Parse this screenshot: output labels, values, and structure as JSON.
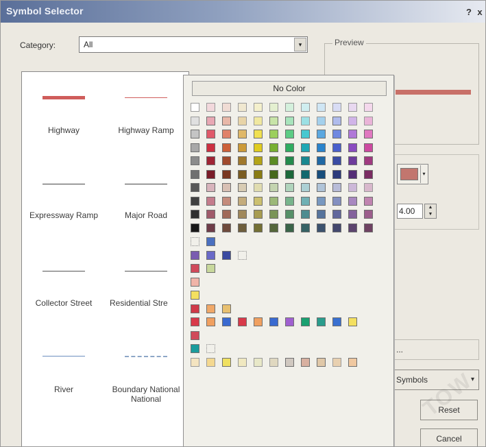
{
  "window": {
    "title": "Symbol Selector",
    "help_glyph": "?",
    "close_glyph": "x"
  },
  "category": {
    "label": "Category:",
    "value": "All",
    "arrow_glyph": "▾"
  },
  "preview": {
    "label": "Preview",
    "line_color": "#c87068"
  },
  "symbols": [
    {
      "label": "Highway",
      "color": "#cf5d5b",
      "weight": "thick"
    },
    {
      "label": "Highway Ramp",
      "color": "#cf5d5b",
      "weight": "thin"
    },
    {
      "label": "Expressway Ramp",
      "color": "#444444",
      "weight": "thin"
    },
    {
      "label": "Major Road",
      "color": "#444444",
      "weight": "thin"
    },
    {
      "label": "Collector Street",
      "color": "#555555",
      "weight": "thin"
    },
    {
      "label": "Residential Stre",
      "color": "#555555",
      "weight": "thin"
    },
    {
      "label": "River",
      "color": "#6c8fbf",
      "weight": "thin"
    },
    {
      "label": "Boundary National",
      "label_line2": "National",
      "color": "#8da6c6",
      "weight": "dashed"
    }
  ],
  "properties": {
    "color": "#c2766e",
    "width_value": "4.00",
    "spin_up": "▲",
    "spin_down": "▼",
    "dropdown_glyph": "▾"
  },
  "buttons": {
    "properties_label": "...",
    "more_symbols_label": "Symbols",
    "reset_label": "Reset",
    "cancel_label": "Cancel",
    "dropdown_glyph": "▾"
  },
  "palette": {
    "no_color_label": "No Color",
    "grid_columns": 12,
    "grid": [
      [
        "#ffffff",
        "#f2d8dc",
        "#f0dcd4",
        "#f0e8d0",
        "#f4f0cc",
        "#e4f0d0",
        "#d4f0dc",
        "#cfeef0",
        "#cfe6f4",
        "#d8dcf4",
        "#e8d8f0",
        "#f4d8ec"
      ],
      [
        "#e0e0e0",
        "#e8a8b4",
        "#e8b8a8",
        "#e8d4a8",
        "#f0e8a0",
        "#c8e4a8",
        "#a8e4bc",
        "#9ce0e4",
        "#a4d0ec",
        "#b0bcec",
        "#d0b4e8",
        "#eab4d8"
      ],
      [
        "#c4c4c4",
        "#e05a6a",
        "#e0826a",
        "#e0b868",
        "#f0e050",
        "#9ccf5c",
        "#5ccc84",
        "#48c8d0",
        "#5ca8e0",
        "#7088e0",
        "#b078d8",
        "#e078c0"
      ],
      [
        "#a8a8a8",
        "#cc3040",
        "#cc6038",
        "#cc9a38",
        "#e0cc20",
        "#78b030",
        "#30ac60",
        "#20a8b4",
        "#2a84cc",
        "#4a60cc",
        "#8a4cc0",
        "#cc4aa0"
      ],
      [
        "#8c8c8c",
        "#a02434",
        "#a04a2c",
        "#a0782c",
        "#b4a418",
        "#5c8c24",
        "#248a4c",
        "#1a8890",
        "#2068a4",
        "#3a4ca4",
        "#6e3c9c",
        "#a03a80"
      ],
      [
        "#707070",
        "#7a1c28",
        "#7a3822",
        "#7a5c22",
        "#8a7c14",
        "#46681c",
        "#1c683a",
        "#14686e",
        "#184e7c",
        "#2c3a7c",
        "#542e76",
        "#7a2c62"
      ],
      [
        "#585858",
        "#d8b4bc",
        "#d8c0b4",
        "#d8ccb4",
        "#e0dcb0",
        "#c4d4b0",
        "#b0d4bc",
        "#acd0d4",
        "#b0c4d8",
        "#b8bcd8",
        "#ccb8d8",
        "#d8b8cc"
      ],
      [
        "#404040",
        "#c47c8c",
        "#c48c7c",
        "#c4ac7c",
        "#ccc070",
        "#9cb878",
        "#78b48c",
        "#70b0b4",
        "#7898c0",
        "#8490c0",
        "#a888c0",
        "#c084b0"
      ],
      [
        "#303030",
        "#a05a6a",
        "#a06a5a",
        "#a0885a",
        "#a89c50",
        "#7a9456",
        "#569068",
        "#4e8c90",
        "#56749c",
        "#62689c",
        "#84629c",
        "#9c5e8c"
      ],
      [
        "#181818",
        "#6e3c48",
        "#6e4a3c",
        "#6e5e3c",
        "#747034",
        "#54663a",
        "#3a6448",
        "#366264",
        "#3c526e",
        "#44486e",
        "#5c446e",
        "#6e4262"
      ]
    ],
    "extra_rows": [
      [
        "outline",
        "#4a70c0"
      ],
      [
        "#7a5cb0",
        "#6a6ac8",
        "#3a4aa0",
        "outline"
      ],
      [
        "#d04a5a",
        "#c8d89c"
      ],
      [
        "#f0b4a8"
      ],
      [
        "#f4e060"
      ],
      [
        "#d03a48",
        "#f0a868",
        "#e8c070"
      ],
      [
        "#d83a4a",
        "#f0a060",
        "#3a6ad0",
        "#d83a4a",
        "#f0a060",
        "#3a6ad0",
        "#a060d0",
        "#1aa070",
        "#2a9c8c",
        "#3a70d0",
        "#f4e060"
      ],
      [
        "#d04a5a"
      ],
      [
        "#1a9c9c",
        "outline"
      ],
      [
        "#f4e4c0",
        "#f4d890",
        "#f0e060",
        "#f0e8c0",
        "#e8e8c8",
        "#e0d8c0",
        "#d0c8c0",
        "#d8b0a0",
        "#e0c8a8",
        "#e8d0b0",
        "#f0c8a0"
      ]
    ]
  },
  "watermark_text": "TOW"
}
